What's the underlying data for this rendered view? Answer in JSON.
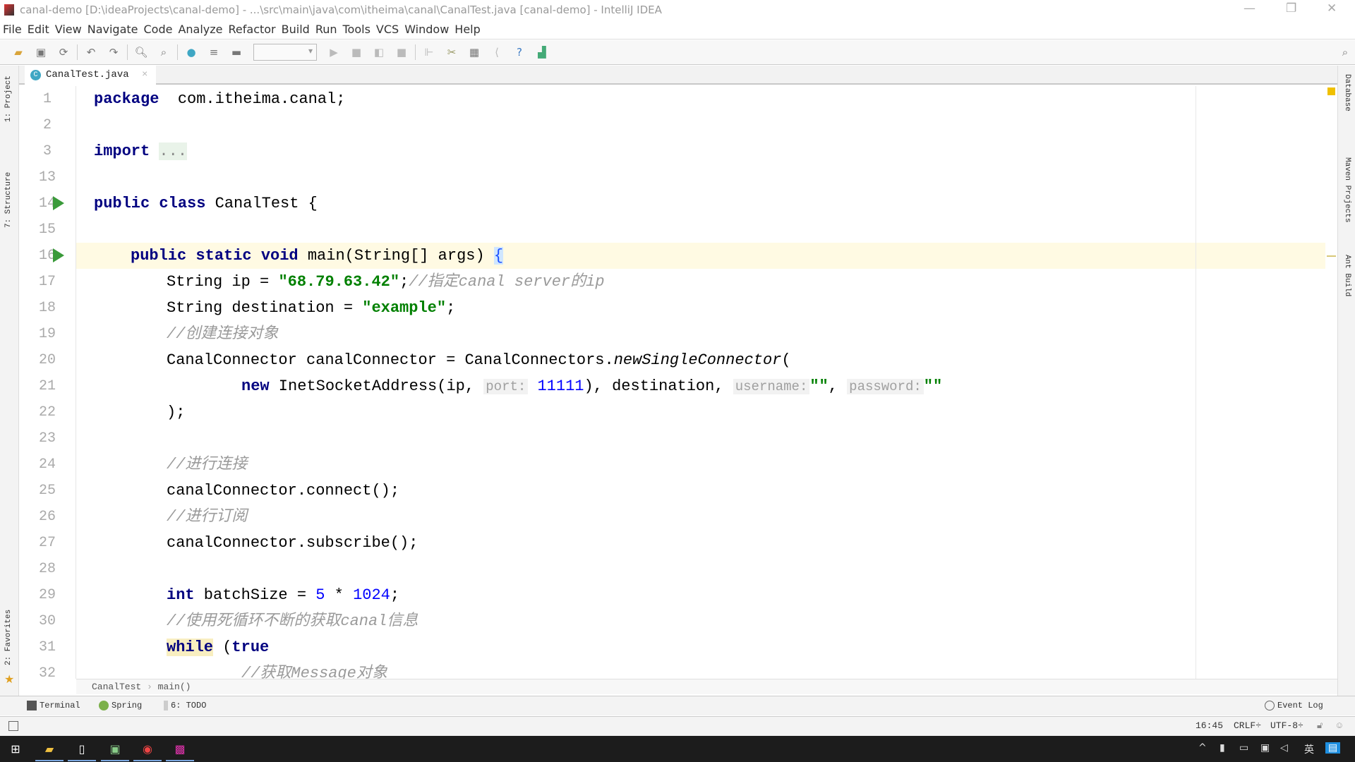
{
  "window": {
    "title": "canal-demo [D:\\ideaProjects\\canal-demo] - ...\\src\\main\\java\\com\\itheima\\canal\\CanalTest.java [canal-demo] - IntelliJ IDEA"
  },
  "menu": [
    "File",
    "Edit",
    "View",
    "Navigate",
    "Code",
    "Analyze",
    "Refactor",
    "Build",
    "Run",
    "Tools",
    "VCS",
    "Window",
    "Help"
  ],
  "tab": {
    "label": "CanalTest.java",
    "icon": "C"
  },
  "left_strip": [
    "1: Project",
    "7: Structure",
    "2: Favorites"
  ],
  "right_strip": [
    "Database",
    "Maven Projects",
    "Ant Build"
  ],
  "code": [
    {
      "n": "1",
      "indent": 0,
      "t": [
        [
          "kw",
          "package"
        ],
        [
          "",
          "  com.itheima.canal;"
        ]
      ]
    },
    {
      "n": "2",
      "indent": 0,
      "t": []
    },
    {
      "n": "3",
      "indent": 0,
      "t": [
        [
          "kw",
          "import"
        ],
        [
          "",
          " "
        ],
        [
          "fold",
          "..."
        ]
      ]
    },
    {
      "n": "13",
      "indent": 0,
      "t": []
    },
    {
      "n": "14",
      "indent": 0,
      "run": true,
      "t": [
        [
          "kw",
          "public class"
        ],
        [
          "",
          " CanalTest {"
        ]
      ]
    },
    {
      "n": "15",
      "indent": 0,
      "t": []
    },
    {
      "n": "16",
      "indent": 1,
      "run": true,
      "current": true,
      "t": [
        [
          "kw",
          "public static void"
        ],
        [
          "",
          " main(String[] args) "
        ],
        [
          "brace",
          "{"
        ]
      ]
    },
    {
      "n": "17",
      "indent": 2,
      "t": [
        [
          "",
          "String ip = "
        ],
        [
          "str",
          "\"68.79.63.42\""
        ],
        [
          "",
          ";"
        ],
        [
          "cmt",
          "//指定canal server的ip"
        ]
      ]
    },
    {
      "n": "18",
      "indent": 2,
      "t": [
        [
          "",
          "String destination = "
        ],
        [
          "str",
          "\"example\""
        ],
        [
          "",
          ";"
        ]
      ]
    },
    {
      "n": "19",
      "indent": 2,
      "t": [
        [
          "cmt",
          "//创建连接对象"
        ]
      ]
    },
    {
      "n": "20",
      "indent": 2,
      "t": [
        [
          "",
          "CanalConnector canalConnector = CanalConnectors."
        ],
        [
          "it",
          "newSingleConnector"
        ],
        [
          "",
          "("
        ]
      ]
    },
    {
      "n": "21",
      "indent": 3,
      "t": [
        [
          "kw",
          "new"
        ],
        [
          "",
          " InetSocketAddress(ip, "
        ],
        [
          "hint",
          "port:"
        ],
        [
          "num",
          " 11111"
        ],
        [
          "",
          "), destination, "
        ],
        [
          "hint",
          "username:"
        ],
        [
          "str",
          "\"\""
        ],
        [
          "",
          ", "
        ],
        [
          "hint",
          "password:"
        ],
        [
          "str",
          "\"\""
        ]
      ]
    },
    {
      "n": "22",
      "indent": 2,
      "t": [
        [
          "",
          ");"
        ]
      ]
    },
    {
      "n": "23",
      "indent": 0,
      "t": []
    },
    {
      "n": "24",
      "indent": 2,
      "t": [
        [
          "cmt",
          "//进行连接"
        ]
      ]
    },
    {
      "n": "25",
      "indent": 2,
      "t": [
        [
          "",
          "canalConnector.connect();"
        ]
      ]
    },
    {
      "n": "26",
      "indent": 2,
      "t": [
        [
          "cmt",
          "//进行订阅"
        ]
      ]
    },
    {
      "n": "27",
      "indent": 2,
      "t": [
        [
          "",
          "canalConnector.subscribe();"
        ]
      ]
    },
    {
      "n": "28",
      "indent": 0,
      "t": []
    },
    {
      "n": "29",
      "indent": 2,
      "t": [
        [
          "kw",
          "int"
        ],
        [
          "",
          " batchSize = "
        ],
        [
          "num",
          "5"
        ],
        [
          "",
          " * "
        ],
        [
          "num",
          "1024"
        ],
        [
          "",
          ";"
        ]
      ]
    },
    {
      "n": "30",
      "indent": 2,
      "t": [
        [
          "cmt",
          "//使用死循环不断的获取canal信息"
        ]
      ]
    },
    {
      "n": "31",
      "indent": 2,
      "t": [
        [
          "kw hl",
          "while"
        ],
        [
          "",
          " ("
        ],
        [
          "kw",
          "true"
        ],
        [
          ") {"
        ]
      ]
    },
    {
      "n": "32",
      "indent": 3,
      "t": [
        [
          "cmt",
          "//获取Message对象"
        ]
      ]
    }
  ],
  "breadcrumb": [
    "CanalTest",
    "main()"
  ],
  "tool_windows": {
    "terminal": "Terminal",
    "spring": "Spring",
    "todo": "6: TODO",
    "event_log": "Event Log"
  },
  "status": {
    "position": "16:45",
    "line_sep": "CRLF÷",
    "encoding": "UTF-8÷"
  },
  "colors": {
    "keyword": "#000080",
    "string": "#008000",
    "number": "#0000ff",
    "comment": "#9a9a9a",
    "current_line": "#fffae3"
  }
}
